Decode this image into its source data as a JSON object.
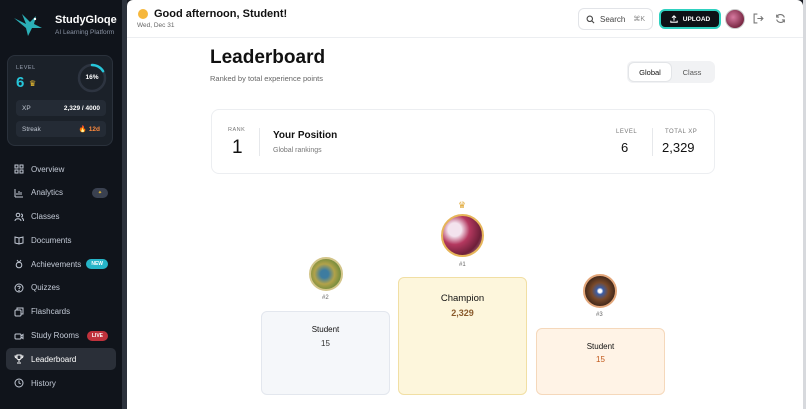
{
  "brand": {
    "name": "StudyGloqe",
    "tagline": "AI Learning Platform"
  },
  "level_card": {
    "level_label": "LEVEL",
    "level": "6",
    "progress_text": "16%",
    "progress": 0.16,
    "xp_label": "XP",
    "xp_value": "2,329 / 4000",
    "streak_label": "Streak",
    "streak_value": "12d"
  },
  "nav": {
    "items": [
      {
        "label": "Overview",
        "icon": "grid-icon"
      },
      {
        "label": "Analytics",
        "icon": "chart-icon",
        "badge": "✦"
      },
      {
        "label": "Classes",
        "icon": "users-icon"
      },
      {
        "label": "Documents",
        "icon": "book-icon"
      },
      {
        "label": "Achievements",
        "icon": "medal-icon",
        "badge": "NEW"
      },
      {
        "label": "Quizzes",
        "icon": "help-circle-icon"
      },
      {
        "label": "Flashcards",
        "icon": "cards-icon"
      },
      {
        "label": "Study Rooms",
        "icon": "video-icon",
        "badge": "LIVE"
      },
      {
        "label": "Leaderboard",
        "icon": "trophy-icon",
        "active": true
      },
      {
        "label": "History",
        "icon": "clock-icon"
      }
    ]
  },
  "topbar": {
    "greeting": "Good afternoon, Student!",
    "date": "Wed, Dec 31",
    "search_label": "Search",
    "search_shortcut": "⌘K",
    "upload_label": "UPLOAD"
  },
  "page": {
    "title": "Leaderboard",
    "subtitle": "Ranked by total experience points",
    "scope_options": [
      "Global",
      "Class"
    ],
    "scope_selected": "Global"
  },
  "position": {
    "rank_label": "RANK",
    "rank": "1",
    "title": "Your Position",
    "subtitle": "Global rankings",
    "level_label": "LEVEL",
    "level": "6",
    "xp_label": "TOTAL XP",
    "xp": "2,329"
  },
  "podium": {
    "first": {
      "rank": "#1",
      "name": "Champion",
      "value": "2,329"
    },
    "second": {
      "rank": "#2",
      "name": "Student",
      "value": "15"
    },
    "third": {
      "rank": "#3",
      "name": "Student",
      "value": "15"
    }
  },
  "colors": {
    "accent": "#26c6da",
    "upload_border": "#2fd1c0",
    "gold_text": "#8a5a2b",
    "bronze_text": "#c0571a"
  }
}
